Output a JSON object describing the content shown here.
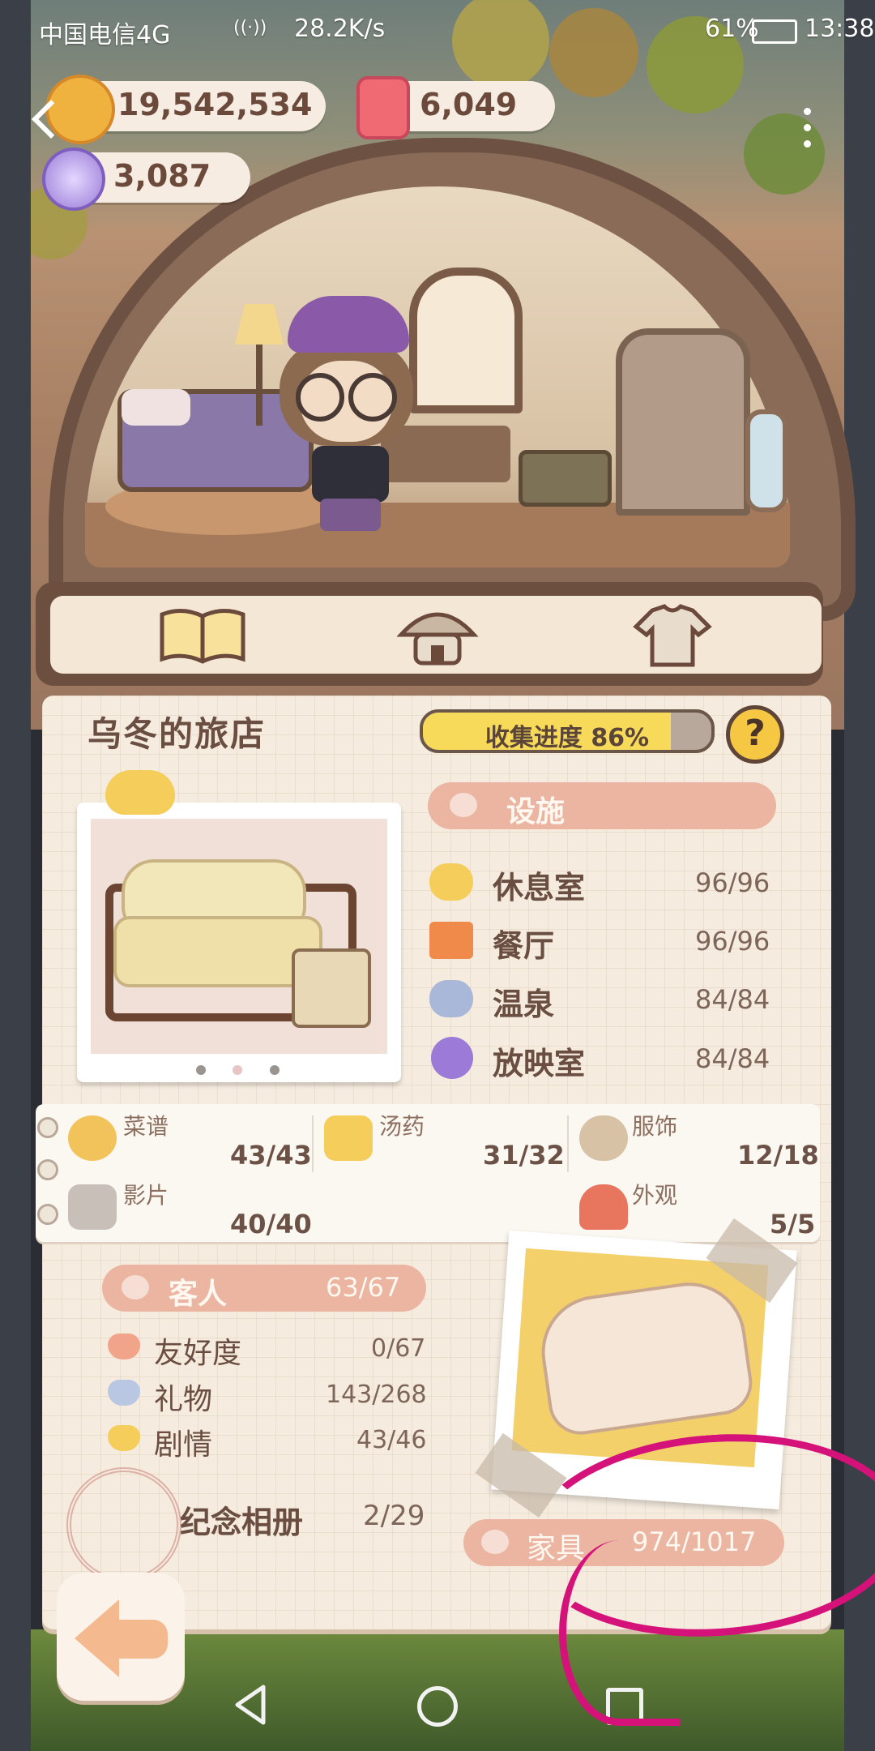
{
  "status_bar": {
    "carrier": "中国电信4G",
    "signal": "4G",
    "speed": "28.2K/s",
    "battery": "61%",
    "time": "13:38"
  },
  "currency": {
    "coins": "19,542,534",
    "candles": "6,049",
    "gems": "3,087"
  },
  "tabs": [
    {
      "icon": "open-book-icon"
    },
    {
      "icon": "hotel-icon"
    },
    {
      "icon": "shirt-icon"
    }
  ],
  "inn": {
    "title": "乌冬的旅店",
    "progress_label": "收集进度",
    "progress_value": "86%",
    "progress_fraction": 0.86
  },
  "facilities": {
    "header": "设施",
    "items": [
      {
        "label": "休息室",
        "value": "96/96",
        "icon": "cloud-icon",
        "color": "#f4cd5b"
      },
      {
        "label": "餐厅",
        "value": "96/96",
        "icon": "utensils-icon",
        "color": "#f08a4b"
      },
      {
        "label": "温泉",
        "value": "84/84",
        "icon": "hot-spring-icon",
        "color": "#a9b7d8"
      },
      {
        "label": "放映室",
        "value": "84/84",
        "icon": "film-reel-icon",
        "color": "#9b7bd7"
      }
    ]
  },
  "categories": {
    "row1": [
      {
        "label": "菜谱",
        "value": "43/43",
        "icon": "dish-icon",
        "color": "#f2c35a"
      },
      {
        "label": "汤药",
        "value": "31/32",
        "icon": "potion-jar-icon",
        "color": "#f4cd5b"
      },
      {
        "label": "服饰",
        "value": "12/18",
        "icon": "bear-doll-icon",
        "color": "#d8c2a5"
      }
    ],
    "row2": [
      {
        "label": "影片",
        "value": "40/40",
        "icon": "clapperboard-icon",
        "color": "#c8c0b8"
      },
      {
        "label": "外观",
        "value": "5/5",
        "icon": "mushroom-house-icon",
        "color": "#e8765f"
      }
    ]
  },
  "guests": {
    "header": "客人",
    "header_value": "63/67",
    "items": [
      {
        "label": "友好度",
        "value": "0/67",
        "icon": "heart-pink-icon",
        "color": "#f2a48a"
      },
      {
        "label": "礼物",
        "value": "143/268",
        "icon": "heart-blue-icon",
        "color": "#b9c7e3"
      },
      {
        "label": "剧情",
        "value": "43/46",
        "icon": "heart-yellow-icon",
        "color": "#f4cd5b"
      }
    ]
  },
  "album": {
    "label": "纪念相册",
    "value": "2/29"
  },
  "furniture": {
    "label": "家具",
    "value": "974/1017"
  },
  "colors": {
    "ribbon": "#eab29e",
    "page": "#f5ecdf",
    "annotation": "#d4127a"
  }
}
